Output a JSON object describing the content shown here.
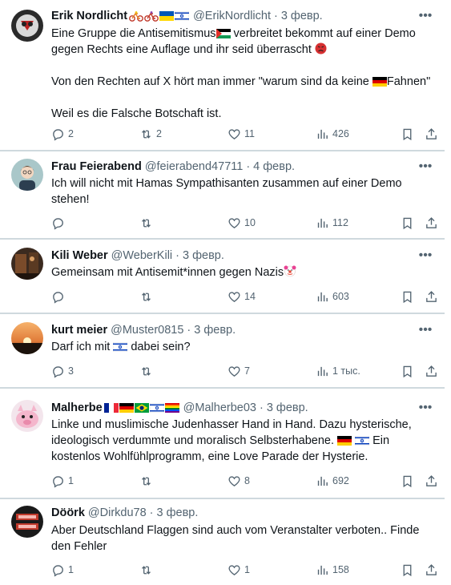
{
  "posts": [
    {
      "name": "Erik Nordlicht",
      "name_emojis": [
        "bicycle",
        "bicycle",
        "flag-ukraine",
        "flag-israel"
      ],
      "handle": "@ErikNordlicht",
      "date": "3 февр.",
      "lines": [
        "Eine Gruppe die Antisemitismus",
        " verbreitet bekommt auf einer Demo",
        "gegen Rechts eine Auflage und ihr seid überrascht",
        "",
        "Von den Rechten auf X hört man immer \"warum sind da keine ",
        "Fahnen\"",
        "",
        "Weil es die Falsche Botschaft ist."
      ],
      "replies": "2",
      "reposts": "2",
      "likes": "11",
      "views": "426"
    },
    {
      "name": "Frau Feierabend",
      "handle": "@feierabend47711",
      "date": "4 февр.",
      "lines": [
        "Ich will nicht mit Hamas Sympathisanten zusammen auf einer Demo",
        "stehen!"
      ],
      "replies": "",
      "reposts": "",
      "likes": "10",
      "views": "112"
    },
    {
      "name": "Kili Weber",
      "handle": "@WeberKili",
      "date": "3 февр.",
      "lines": [
        "Gemeinsam mit Antisemit*innen gegen Nazis"
      ],
      "replies": "",
      "reposts": "",
      "likes": "14",
      "views": "603"
    },
    {
      "name": "kurt meier",
      "handle": "@Muster0815",
      "date": "3 февр.",
      "lines": [
        "Darf ich mit ",
        " dabei sein?"
      ],
      "replies": "3",
      "reposts": "",
      "likes": "7",
      "views": "1 тыс."
    },
    {
      "name": "Malherbe",
      "name_emojis": [
        "flag-france",
        "flag-germany",
        "flag-brazil",
        "flag-israel",
        "flag-rainbow"
      ],
      "handle": "@Malherbe03",
      "date": "3 февр.",
      "lines": [
        "Linke und muslimische Judenhasser Hand in Hand. Dazu hysterische,",
        "ideologisch verdummte und moralisch Selbsterhabene. ",
        " Ein",
        "kostenlos Wohlfühlprogramm, eine Love Parade der Hysterie."
      ],
      "replies": "1",
      "reposts": "",
      "likes": "8",
      "views": "692"
    },
    {
      "name": "Döörk",
      "handle": "@Dirkdu78",
      "date": "3 февр.",
      "lines": [
        "Aber Deutschland Flaggen sind auch vom Veranstalter verboten.. Finde",
        "den Fehler"
      ],
      "replies": "1",
      "reposts": "",
      "likes": "1",
      "views": "158"
    }
  ],
  "icons": {
    "reply": "reply-icon",
    "repost": "repost-icon",
    "like": "heart-icon",
    "views": "views-icon",
    "bookmark": "bookmark-icon",
    "share": "share-icon",
    "more": "more-icon"
  },
  "colors": {
    "text": "#0f1419",
    "muted": "#536471",
    "divider": "#eff3f4"
  }
}
